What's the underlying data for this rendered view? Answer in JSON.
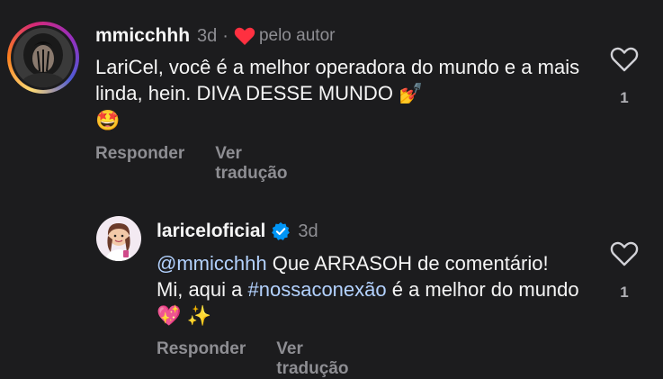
{
  "comments": [
    {
      "username": "mmicchhh",
      "time": "3d",
      "separator": "·",
      "liked_by_author_label": "pelo autor",
      "text_part1": "LariCel, você é a melhor operadora do mundo e a mais linda, hein. DIVA DESSE MUNDO",
      "emoji_1": "💅",
      "emoji_2": "🤩",
      "reply_label": "Responder",
      "translate_label": "Ver tradução",
      "like_count": "1"
    },
    {
      "username": "lariceloficial",
      "verified": true,
      "time": "3d",
      "mention": "@mmicchhh",
      "text_part1": " Que ARRASOH de comentário! Mi, aqui a ",
      "hashtag": "#nossaconexão",
      "text_part2": " é a melhor do mundo ",
      "emoji_1": "💖",
      "emoji_2": "✨",
      "reply_label": "Responder",
      "translate_label": "Ver tradução",
      "like_count": "1"
    }
  ],
  "colors": {
    "background": "#1c1c1e",
    "heart_red": "#ff3040",
    "verified_blue": "#0095f6",
    "secondary_text": "#8e8e93",
    "link_text": "#b3d2ff"
  }
}
